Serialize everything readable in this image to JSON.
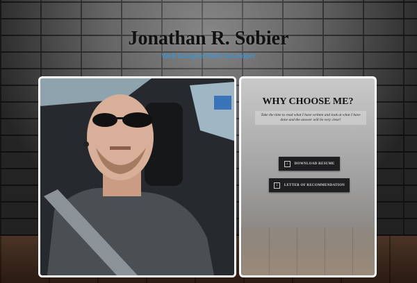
{
  "header": {
    "name": "Jonathan R. Sobier",
    "subtitle": "Web Designer/Web Developer"
  },
  "photo": {
    "alt": "portrait-photo"
  },
  "info": {
    "title": "WHY CHOOSE ME?",
    "text": "Take the time to read what I have written and look at what I have done and the answer will be very clear!",
    "buttons": {
      "resume_label": "DOWNLOAD RESUME",
      "letter_label": "LETTER OF RECOMMENDATION"
    },
    "button_icon": "download-icon"
  },
  "colors": {
    "subtitle": "#2a9be8",
    "button_bg": "#1f1f22",
    "card_border": "#ffffff"
  }
}
